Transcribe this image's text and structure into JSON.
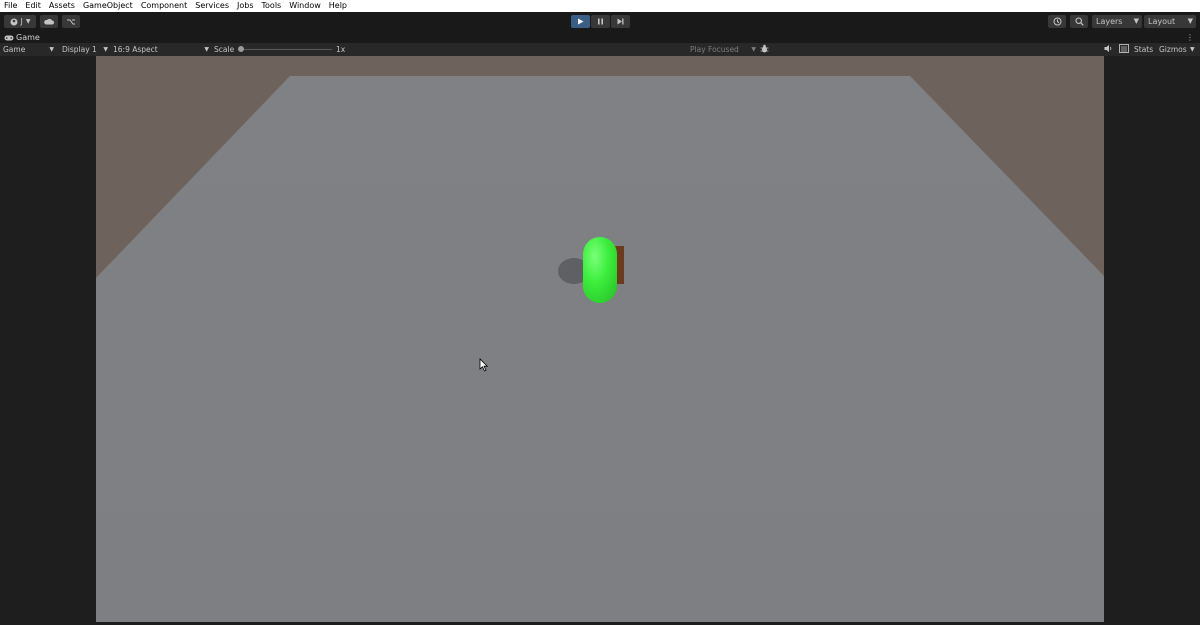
{
  "menu": [
    "File",
    "Edit",
    "Assets",
    "GameObject",
    "Component",
    "Services",
    "Jobs",
    "Tools",
    "Window",
    "Help"
  ],
  "toolbar": {
    "account_label": "J",
    "layers_label": "Layers",
    "layout_label": "Layout"
  },
  "tab": {
    "label": "Game"
  },
  "controls": {
    "view_mode": "Game",
    "display": "Display 1",
    "aspect": "16:9 Aspect",
    "scale_label": "Scale",
    "scale_value": "1x",
    "play_mode": "Play Focused",
    "stats_label": "Stats",
    "gizmos_label": "Gizmos"
  },
  "colors": {
    "sky": "#6e625c",
    "floor": "#818387",
    "player": "#3cee3c",
    "crate": "#6b3a1f",
    "play_active": "#3a5f87"
  },
  "icons": [
    "account-icon",
    "cloud-icon",
    "version-control-icon",
    "play-icon",
    "pause-icon",
    "step-icon",
    "history-icon",
    "search-icon",
    "kebab-icon",
    "game-controller-icon",
    "bug-icon",
    "audio-icon",
    "stats-icon"
  ]
}
